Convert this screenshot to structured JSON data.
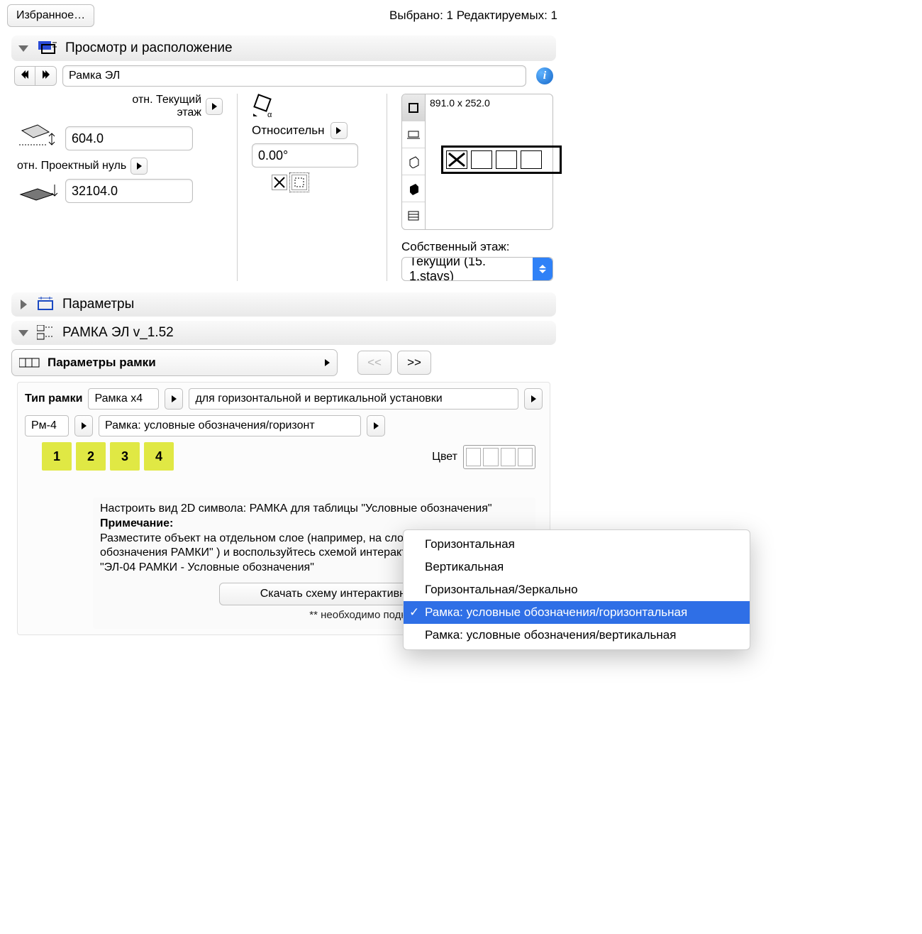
{
  "topbar": {
    "favorites": "Избранное…",
    "status": "Выбрано: 1 Редактируемых: 1"
  },
  "panels": {
    "preview": {
      "title": "Просмотр и расположение",
      "object_name": "Рамка ЭЛ",
      "rel_current": "отн. Текущий этаж",
      "height1": "604.0",
      "rel_zero": "отн. Проектный нуль",
      "height2": "32104.0",
      "relative": "Относительн",
      "angle": "0.00°",
      "dim": "891.0 x 252.0",
      "own_storey": "Собственный этаж:",
      "storey_value": "Текущий (15. 1.stavs)"
    },
    "params": {
      "title": "Параметры"
    },
    "ramka": {
      "title": "РАМКА ЭЛ v_1.52"
    }
  },
  "subheader": {
    "title": "Параметры рамки",
    "prev": "<<",
    "next": ">>"
  },
  "frame": {
    "type_label": "Тип рамки",
    "type_value": "Рамка x4",
    "install": "для горизонтальной и вертикальной установки",
    "code": "Рм-4",
    "desc": "Рамка: условные обозначения/горизонт",
    "tiles": [
      "1",
      "2",
      "3",
      "4"
    ],
    "color_label": "Цвет",
    "note_line1": "Настроить вид 2D символа: РАМКА для таблицы \"Условные обозначения\"",
    "note_head": "Примечание:",
    "note_body": "Разместите объект на отдельном слое (например, на слое: \"Условные обозначения РАМКИ\" ) и воспользуйтесь схемой интерактивного каталога \"ЭЛ-04 РАМКИ - Условные обозначения\"",
    "download": "Скачать схему интерактивного каталога **",
    "footnote": "** необходимо подключение к ИНТЕРНЕТ'у"
  },
  "popup": {
    "items": [
      "Горизонтальная",
      "Вертикальная",
      "Горизонтальная/Зеркально",
      "Рамка: условные обозначения/горизонтальная",
      "Рамка: условные обозначения/вертикальная"
    ],
    "selected": 3
  }
}
